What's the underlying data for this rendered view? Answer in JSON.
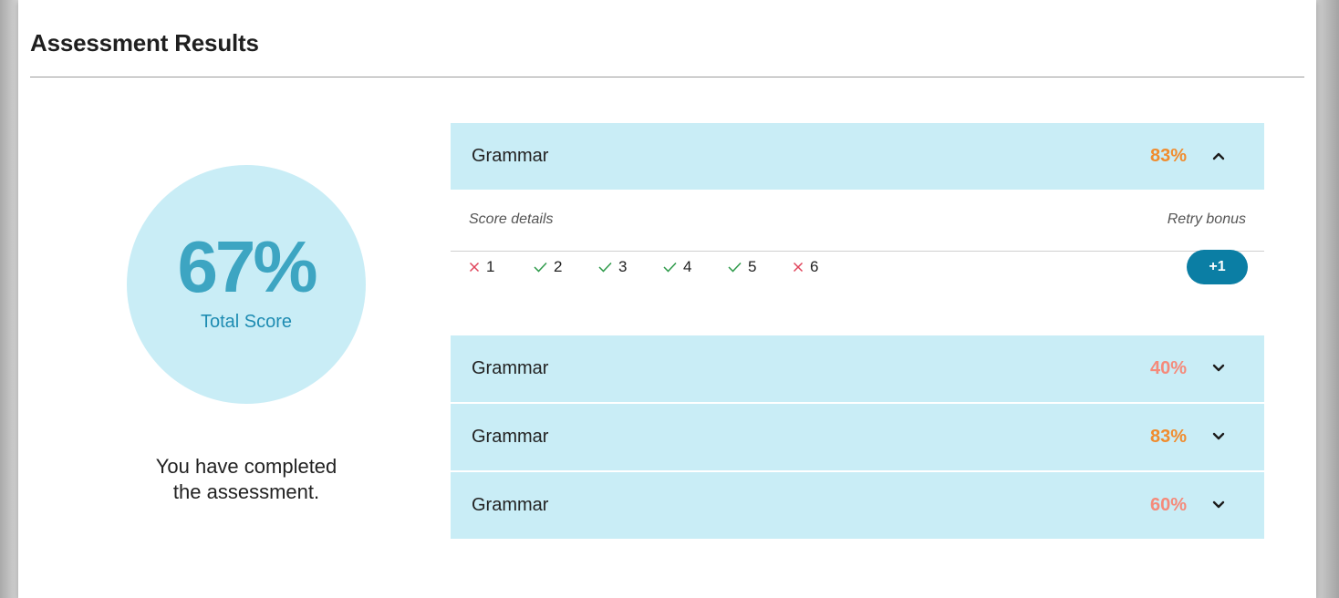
{
  "page": {
    "title": "Assessment Results"
  },
  "summary": {
    "total_score": "67%",
    "total_score_label": "Total Score",
    "completed_line1": "You have completed",
    "completed_line2": "the assessment."
  },
  "colors": {
    "accent_score": "#3da5c2",
    "section_bg": "#c9edf6",
    "pct_orange": "#f08c2e",
    "pct_salmon": "#f58a7a",
    "bonus_button": "#0b7ea4",
    "wrong_mark": "#e0455c",
    "correct_mark": "#2e9a4a"
  },
  "sections": [
    {
      "name": "Grammar",
      "percent": "83%",
      "percent_color": "#f08c2e",
      "expanded": true,
      "chevron": "chevron-up-icon",
      "details": {
        "score_details_label": "Score details",
        "retry_bonus_label": "Retry bonus",
        "questions": [
          {
            "number": "1",
            "result": "incorrect",
            "icon": "cross-icon"
          },
          {
            "number": "2",
            "result": "correct",
            "icon": "check-icon"
          },
          {
            "number": "3",
            "result": "correct",
            "icon": "check-icon"
          },
          {
            "number": "4",
            "result": "correct",
            "icon": "check-icon"
          },
          {
            "number": "5",
            "result": "correct",
            "icon": "check-icon"
          },
          {
            "number": "6",
            "result": "incorrect",
            "icon": "cross-icon"
          }
        ],
        "retry_bonus_value": "+1"
      }
    },
    {
      "name": "Grammar",
      "percent": "40%",
      "percent_color": "#f58a7a",
      "expanded": false,
      "chevron": "chevron-down-icon"
    },
    {
      "name": "Grammar",
      "percent": "83%",
      "percent_color": "#f08c2e",
      "expanded": false,
      "chevron": "chevron-down-icon"
    },
    {
      "name": "Grammar",
      "percent": "60%",
      "percent_color": "#f58a7a",
      "expanded": false,
      "chevron": "chevron-down-icon"
    }
  ]
}
